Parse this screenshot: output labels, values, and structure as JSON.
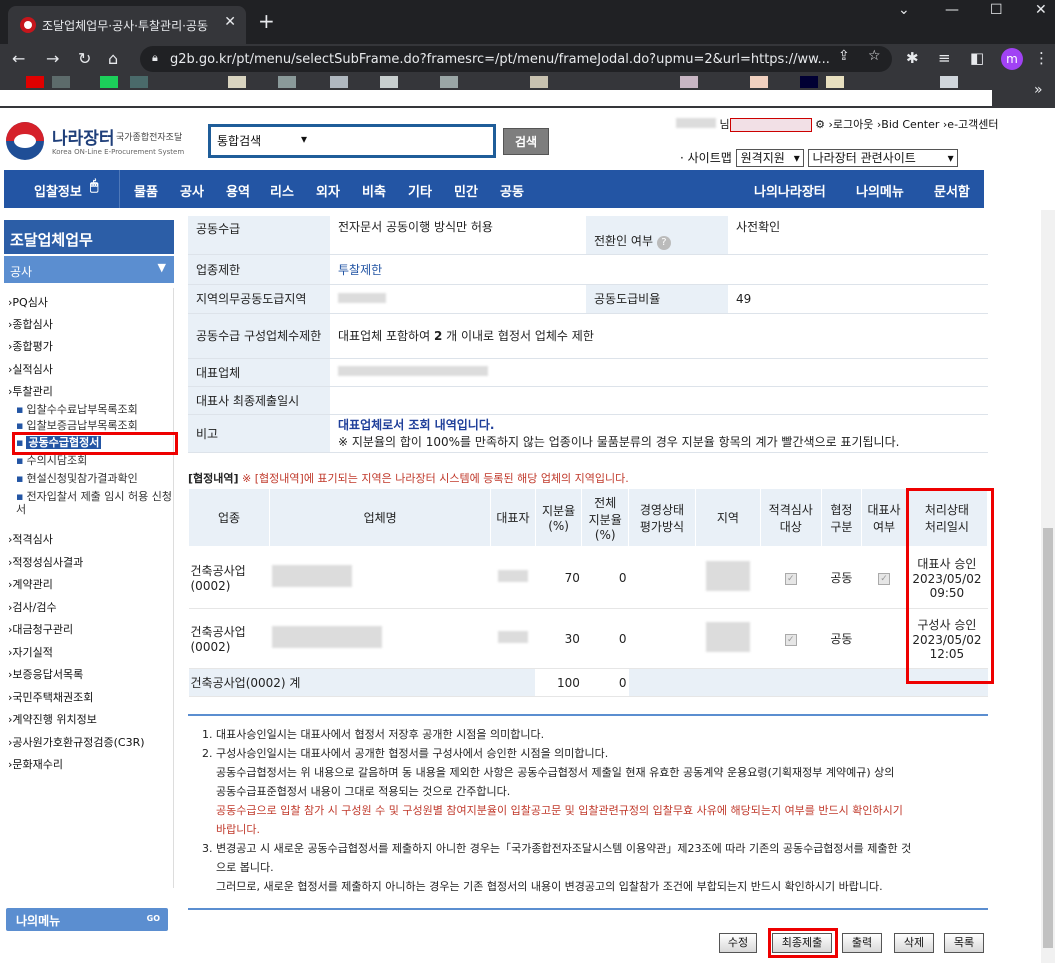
{
  "browser": {
    "tab_title": "조달업체업무·공사·투찰관리·공동",
    "url": "g2b.go.kr/pt/menu/selectSubFrame.do?framesrc=/pt/menu/frameJodal.do?upmu=2&url=https://ww...",
    "avatar_letter": "m"
  },
  "header": {
    "logo_main": "나라장터",
    "logo_sub": "국가종합전자조달",
    "logo_en": "Korea ON-Line E-Procurement System",
    "search_select": "통합검색",
    "search_button": "검색",
    "user_suffix": "님",
    "links": [
      "›로그아웃",
      "›Bid Center",
      "›e-고객센터"
    ],
    "sitemap_label": "· 사이트맵",
    "select_remote": "원격지원",
    "select_related": "나라장터 관련사이트"
  },
  "nav": {
    "items": [
      "입찰정보",
      "물품",
      "공사",
      "용역",
      "리스",
      "외자",
      "비축",
      "기타",
      "민간",
      "공동"
    ],
    "right_items": [
      "나의나라장터",
      "나의메뉴",
      "문서함"
    ]
  },
  "sidebar": {
    "title": "조달업체업무",
    "category": "공사",
    "items": [
      "›PQ심사",
      "›종합심사",
      "›종합평가",
      "›실적심사",
      "›투찰관리"
    ],
    "sub_items": [
      "입찰수수료납부목록조회",
      "입찰보증금납부목록조회",
      "공동수급협정서",
      "수의시담조회",
      "현설신청및참가결과확인",
      "전자입찰서 제출 임시 허용 신청서"
    ],
    "items2": [
      "›적격심사",
      "›적정성심사결과",
      "›계약관리",
      "›검사/검수",
      "›대금청구관리",
      "›자기실적",
      "›보증응답서목록",
      "›국민주택채권조회",
      "›계약진행 위치정보",
      "›공사원가호환규정검증(C3R)",
      "›문화재수리"
    ],
    "my_menu": "나의메뉴",
    "my_menu_go": "GO"
  },
  "info": {
    "row1_label": "공동수급",
    "row1_value": "전자문서 공동이행 방식만 허용",
    "row1_label2": "전환인 여부",
    "row1_value2": "사전확인",
    "row2_label": "업종제한",
    "row2_value": "투찰제한",
    "row3_label": "지역의무공동도급지역",
    "row3_label2": "공동도급비율",
    "row3_value2": "49",
    "row4_label": "공동수급 구성업체수제한",
    "row4_value_pre": "대표업체 포함하여 ",
    "row4_value_num": "2",
    "row4_value_post": " 개 이내로 협정서 업체수 제한",
    "row5_label": "대표업체",
    "row6_label": "대표사 최종제출일시",
    "row7_label": "비고",
    "row7_value1": "대표업체로서 조회 내역입니다.",
    "row7_value2": "※ 지분율의 합이 100%를 만족하지 않는 업종이나 물품분류의 경우 지분율 항목의 계가 빨간색으로 표기됩니다."
  },
  "agreement": {
    "section_title": "[협정내역]",
    "section_note": " ※ [협정내역]에 표기되는 지역은 나라장터 시스템에 등록된 해당 업체의 지역입니다.",
    "headers": [
      "업종",
      "업체명",
      "대표자",
      "지분율(%)",
      "전체지분율(%)",
      "경영상태평가방식",
      "지역",
      "적격심사대상",
      "협정구분",
      "대표사여부",
      "처리상태처리일시"
    ],
    "rows": [
      {
        "industry": "건축공사업(0002)",
        "share": "70",
        "total_share": "0",
        "agreement_type": "공동",
        "status": "대표사 승인",
        "date": "2023/05/02",
        "time": "09:50"
      },
      {
        "industry": "건축공사업(0002)",
        "share": "30",
        "total_share": "0",
        "agreement_type": "공동",
        "status": "구성사 승인",
        "date": "2023/05/02",
        "time": "12:05"
      }
    ],
    "total_label": "건축공사업(0002)  계",
    "total_share": "100",
    "total_total": "0"
  },
  "notes": {
    "n1": "1. 대표사승인일시는 대표사에서 협정서 저장후 공개한 시점을 의미합니다.",
    "n2": "2. 구성사승인일시는 대표사에서 공개한 협정서를 구성사에서 승인한 시점을 의미합니다.",
    "n2a": "공동수급협정서는 위 내용으로 갈음하며 동 내용을 제외한 사항은 공동수급협정서 제출일 현재 유효한 공동계약 운용요령(기획재정부 계약예규) 상의",
    "n2b": "공동수급표준협정서 내용이 그대로 적용되는 것으로 간주합니다.",
    "n2c": "공동수급으로 입찰 참가 시 구성원 수 및 구성원별 참여지분율이 입찰공고문 및 입찰관련규정의 입찰무효 사유에 해당되는지 여부를 반드시 확인하시기",
    "n2d": "바랍니다.",
    "n3": "3. 변경공고 시 새로운 공동수급협정서를 제출하지 아니한 경우는「국가종합전자조달시스템 이용약관」제23조에 따라 기존의 공동수급협정서를 제출한 것",
    "n3a": "으로 봅니다.",
    "n3b": "그러므로, 새로운 협정서를 제출하지 아니하는 경우는 기존 협정서의 내용이 변경공고의 입찰참가 조건에 부합되는지 반드시 확인하시기 바랍니다."
  },
  "buttons": {
    "edit": "수정",
    "final_submit": "최종제출",
    "print": "출력",
    "delete": "삭제",
    "list": "목록"
  },
  "colors": {
    "nav_blue": "#2355a4",
    "label_bg": "#e9f0f7",
    "highlight_red": "#e00000"
  }
}
